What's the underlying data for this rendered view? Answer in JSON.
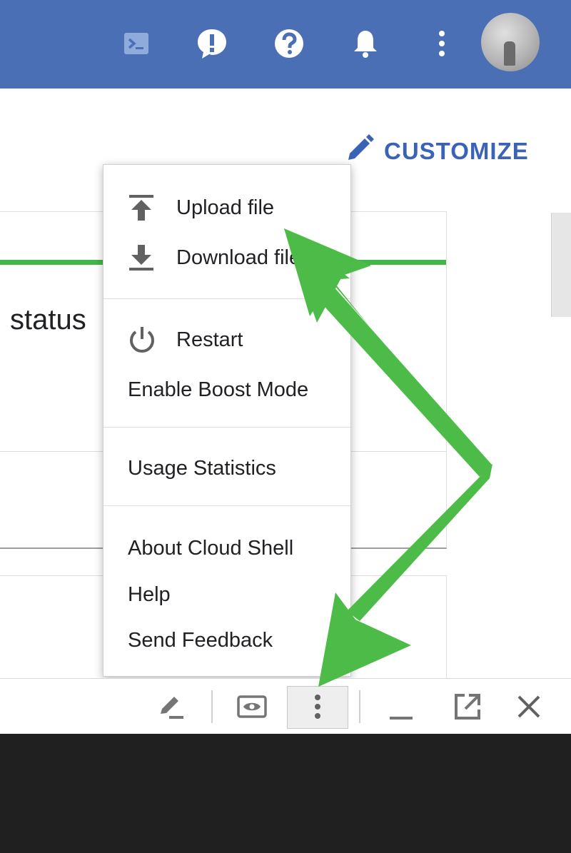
{
  "topbar": {
    "icons": [
      "cloud-shell-icon",
      "feedback-icon",
      "help-icon",
      "notifications-icon",
      "more-vert-icon"
    ],
    "color": "#4a6fb5"
  },
  "page": {
    "customize_label": "CUSTOMIZE",
    "status_label": "status",
    "accent_color": "#3a63b8",
    "status_bar_color": "#43b649"
  },
  "menu": {
    "items": [
      {
        "label": "Upload file",
        "icon": "upload-icon"
      },
      {
        "label": "Download file",
        "icon": "download-icon"
      },
      {
        "label": "Restart",
        "icon": "power-icon"
      },
      {
        "label": "Enable Boost Mode"
      },
      {
        "label": "Usage Statistics"
      },
      {
        "label": "About Cloud Shell"
      },
      {
        "label": "Help"
      },
      {
        "label": "Send Feedback"
      }
    ]
  },
  "shellbar": {
    "icons": [
      "edit-icon",
      "web-preview-icon",
      "more-vert-icon",
      "minimize-icon",
      "open-new-window-icon",
      "close-icon"
    ]
  },
  "annotation": {
    "arrow_color": "#4cbb47"
  }
}
